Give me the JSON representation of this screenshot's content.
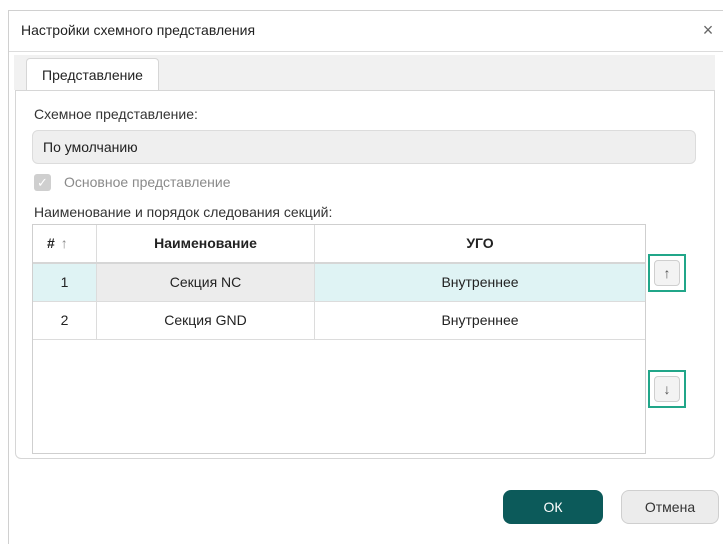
{
  "dialog": {
    "title": "Настройки схемного представления",
    "close_icon": "×"
  },
  "tabs": [
    {
      "label": "Представление"
    }
  ],
  "schema": {
    "label": "Схемное представление:",
    "value": "По умолчанию"
  },
  "main_view": {
    "label": "Основное представление",
    "checked": true,
    "check_glyph": "✓"
  },
  "sections": {
    "label": "Наименование и порядок следования секций:",
    "columns": [
      "#",
      "Наименование",
      "УГО"
    ],
    "sort_icon": "↑",
    "rows": [
      {
        "num": "1",
        "name": "Секция NC",
        "ugo": "Внутреннее"
      },
      {
        "num": "2",
        "name": "Секция GND",
        "ugo": "Внутреннее"
      }
    ],
    "move_up_icon": "↑",
    "move_down_icon": "↓"
  },
  "buttons": {
    "ok": "ОК",
    "cancel": "Отмена"
  },
  "colors": {
    "accent": "#0c5a5a",
    "highlight_border": "#21a689",
    "selected_row": "#dff3f4"
  }
}
